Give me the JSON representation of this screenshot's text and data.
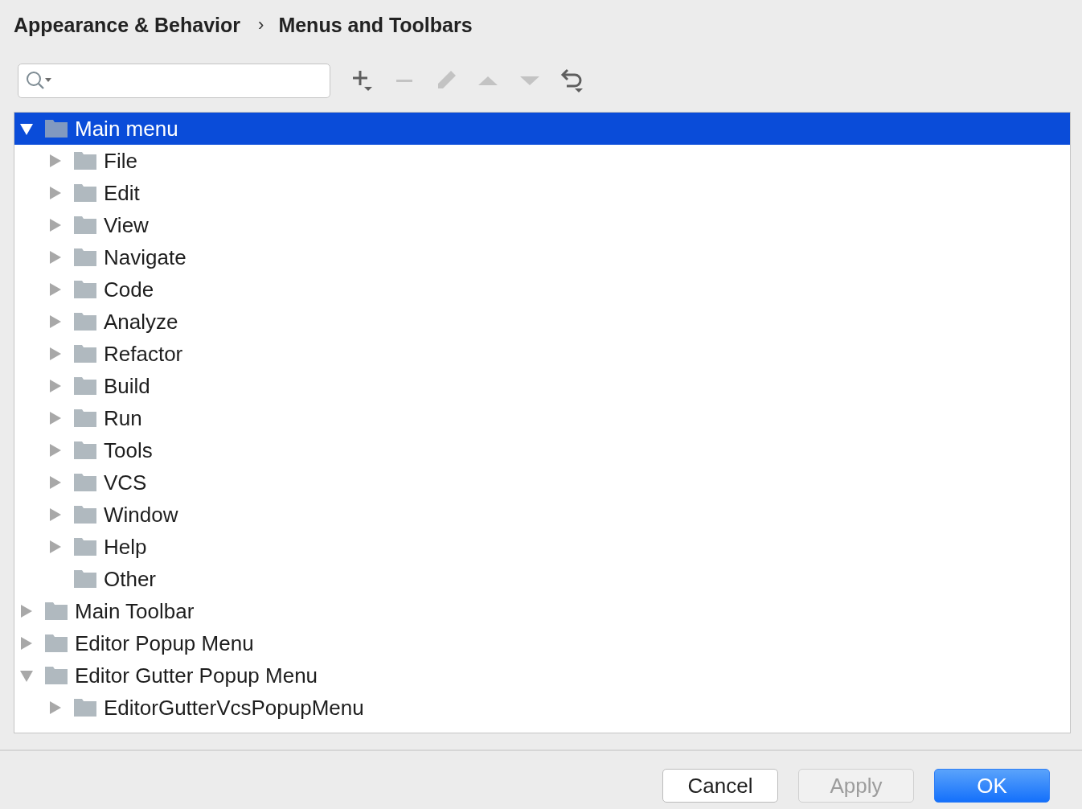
{
  "breadcrumb": {
    "parent": "Appearance & Behavior",
    "separator": "›",
    "current": "Menus and Toolbars"
  },
  "toolbar": [
    {
      "kind": "add",
      "disabled": false
    },
    {
      "kind": "remove",
      "disabled": true
    },
    {
      "kind": "edit",
      "disabled": true
    },
    {
      "kind": "up",
      "disabled": true
    },
    {
      "kind": "down",
      "disabled": true
    },
    {
      "kind": "restore",
      "disabled": false
    }
  ],
  "tree": [
    {
      "label": "Main menu",
      "kind": "expandable",
      "expanded": true,
      "selected": true,
      "children": [
        {
          "label": "File",
          "kind": "expandable",
          "expanded": false,
          "selected": false
        },
        {
          "label": "Edit",
          "kind": "expandable",
          "expanded": false,
          "selected": false
        },
        {
          "label": "View",
          "kind": "expandable",
          "expanded": false,
          "selected": false
        },
        {
          "label": "Navigate",
          "kind": "expandable",
          "expanded": false,
          "selected": false
        },
        {
          "label": "Code",
          "kind": "expandable",
          "expanded": false,
          "selected": false
        },
        {
          "label": "Analyze",
          "kind": "expandable",
          "expanded": false,
          "selected": false
        },
        {
          "label": "Refactor",
          "kind": "expandable",
          "expanded": false,
          "selected": false
        },
        {
          "label": "Build",
          "kind": "expandable",
          "expanded": false,
          "selected": false
        },
        {
          "label": "Run",
          "kind": "expandable",
          "expanded": false,
          "selected": false
        },
        {
          "label": "Tools",
          "kind": "expandable",
          "expanded": false,
          "selected": false
        },
        {
          "label": "VCS",
          "kind": "expandable",
          "expanded": false,
          "selected": false
        },
        {
          "label": "Window",
          "kind": "expandable",
          "expanded": false,
          "selected": false
        },
        {
          "label": "Help",
          "kind": "expandable",
          "expanded": false,
          "selected": false
        },
        {
          "label": "Other",
          "kind": "empty",
          "selected": false
        }
      ]
    },
    {
      "label": "Main Toolbar",
      "kind": "expandable",
      "expanded": false,
      "selected": false
    },
    {
      "label": "Editor Popup Menu",
      "kind": "expandable",
      "expanded": false,
      "selected": false
    },
    {
      "label": "Editor Gutter Popup Menu",
      "kind": "expandable",
      "expanded": true,
      "selected": false,
      "children": [
        {
          "label": "EditorGutterVcsPopupMenu",
          "kind": "expandable",
          "expanded": false,
          "selected": false
        }
      ]
    }
  ],
  "buttons": [
    {
      "label": "Cancel",
      "kind": "normal",
      "disabled": false
    },
    {
      "label": "Apply",
      "kind": "normal",
      "disabled": true
    },
    {
      "label": "OK",
      "kind": "default",
      "disabled": false
    }
  ]
}
